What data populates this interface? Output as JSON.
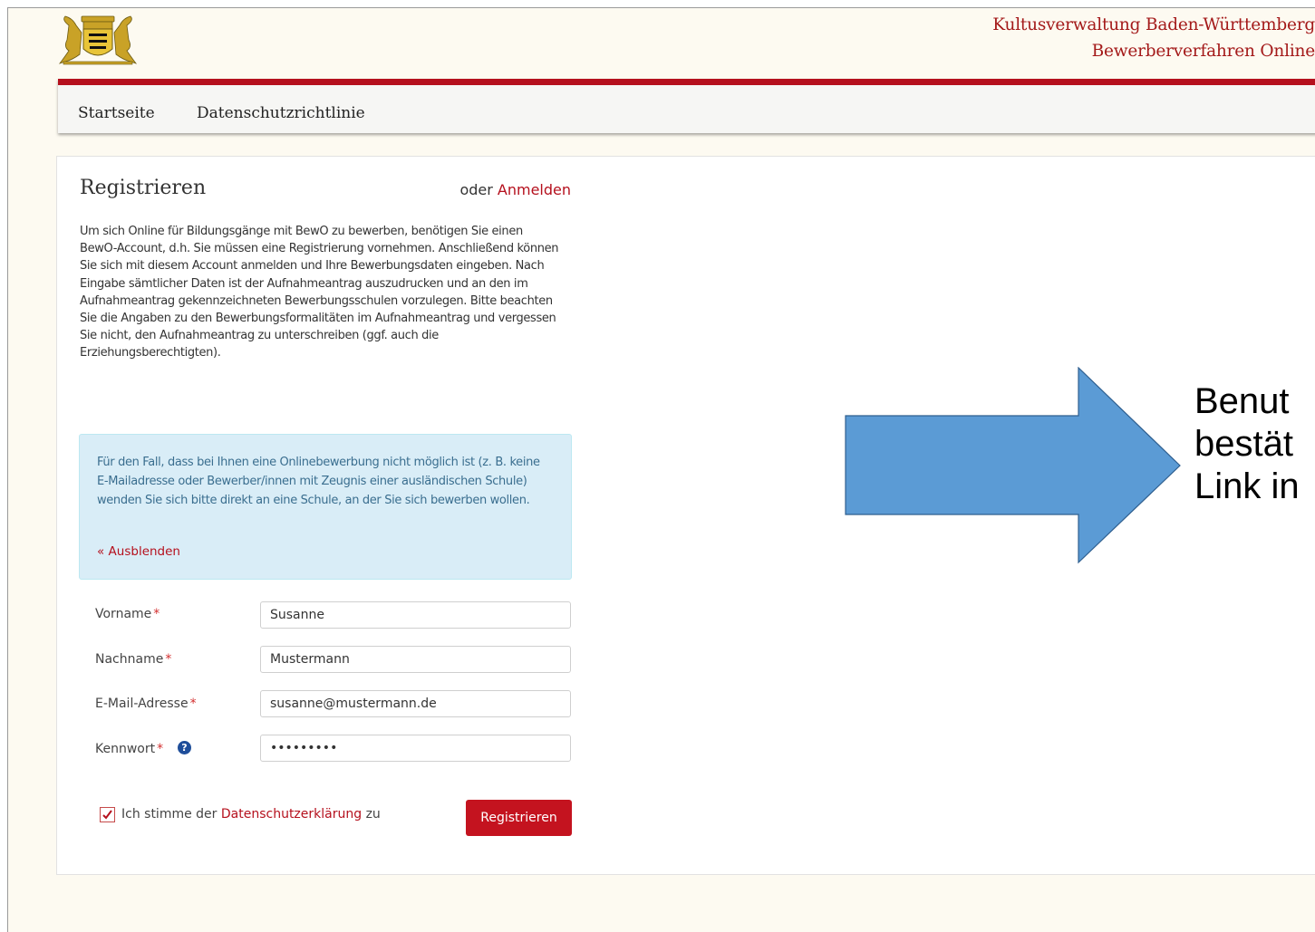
{
  "header": {
    "org_title": "Kultusverwaltung Baden-Württemberg",
    "org_subtitle": "Bewerberverfahren Online",
    "crest_icon": "coat-of-arms-icon"
  },
  "nav": {
    "items": [
      {
        "label": "Startseite"
      },
      {
        "label": "Datenschutzrichtlinie"
      }
    ]
  },
  "register": {
    "title": "Registrieren",
    "or_text": "oder ",
    "login_link": "Anmelden",
    "intro": "Um sich Online für Bildungsgänge mit BewO zu bewerben, benötigen Sie einen BewO-Account, d.h. Sie müssen eine Registrierung vornehmen. Anschließend können Sie sich mit diesem Account anmelden und Ihre Bewerbungsdaten eingeben. Nach Eingabe sämtlicher Daten ist der Aufnahmeantrag auszudrucken und an den im Aufnahmeantrag gekennzeichneten Bewerbungsschulen vorzulegen. Bitte beachten Sie die Angaben zu den Bewerbungsformalitäten im Aufnahmeantrag und vergessen Sie nicht, den Aufnahmeantrag zu unterschreiben (ggf. auch die Erziehungsberechtigten).",
    "info_text": "Für den Fall, dass bei Ihnen eine Onlinebewerbung nicht möglich ist (z. B. keine E-Mailadresse oder Bewerber/innen mit Zeugnis einer ausländischen Schule) wenden Sie sich bitte direkt an eine Schule, an der Sie sich bewerben wollen.",
    "hide_link": "« Ausblenden"
  },
  "form": {
    "required_mark": "*",
    "firstname": {
      "label": "Vorname",
      "value": "Susanne"
    },
    "lastname": {
      "label": "Nachname",
      "value": "Mustermann"
    },
    "email": {
      "label": "E-Mail-Adresse",
      "value": "susanne@mustermann.de"
    },
    "password": {
      "label": "Kennwort",
      "value": "abcdefghi"
    },
    "help_icon": "?",
    "consent_prefix": "Ich stimme der ",
    "consent_link": "Datenschutzerklärung",
    "consent_suffix": " zu",
    "consent_checked": true,
    "submit_label": "Registrieren"
  },
  "overlay": {
    "lines": [
      "Benut",
      "bestät",
      "Link in"
    ],
    "arrow_color": "#5b9bd5"
  }
}
